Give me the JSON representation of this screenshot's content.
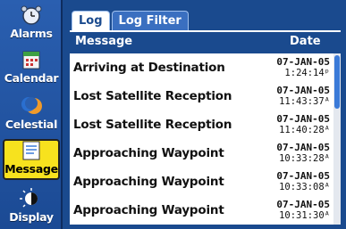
{
  "sidebar": {
    "items": [
      {
        "label": "Alarms",
        "icon": "alarm-clock-icon"
      },
      {
        "label": "Calendar",
        "icon": "calendar-icon"
      },
      {
        "label": "Celestial",
        "icon": "moon-sun-icon"
      },
      {
        "label": "Message",
        "icon": "message-icon"
      },
      {
        "label": "Display",
        "icon": "display-icon"
      }
    ],
    "active_index": 3
  },
  "tabs": [
    {
      "label": "Log",
      "active": true
    },
    {
      "label": "Log Filter",
      "active": false
    }
  ],
  "table": {
    "header_message": "Message",
    "header_date": "Date",
    "rows": [
      {
        "message": "Arriving at Destination",
        "date": "07-JAN-05",
        "time": "1:24:14ᵖ"
      },
      {
        "message": "Lost Satellite Reception",
        "date": "07-JAN-05",
        "time": "11:43:37ᴬ"
      },
      {
        "message": "Lost Satellite Reception",
        "date": "07-JAN-05",
        "time": "11:40:28ᴬ"
      },
      {
        "message": "Approaching Waypoint",
        "date": "07-JAN-05",
        "time": "10:33:28ᴬ"
      },
      {
        "message": "Approaching Waypoint",
        "date": "07-JAN-05",
        "time": "10:33:08ᴬ"
      },
      {
        "message": "Approaching Waypoint",
        "date": "07-JAN-05",
        "time": "10:31:30ᴬ"
      }
    ]
  },
  "colors": {
    "background": "#1a4a8e",
    "highlight": "#f7e21e",
    "list_bg": "#ffffff",
    "scroll_thumb": "#3b7ad8"
  }
}
